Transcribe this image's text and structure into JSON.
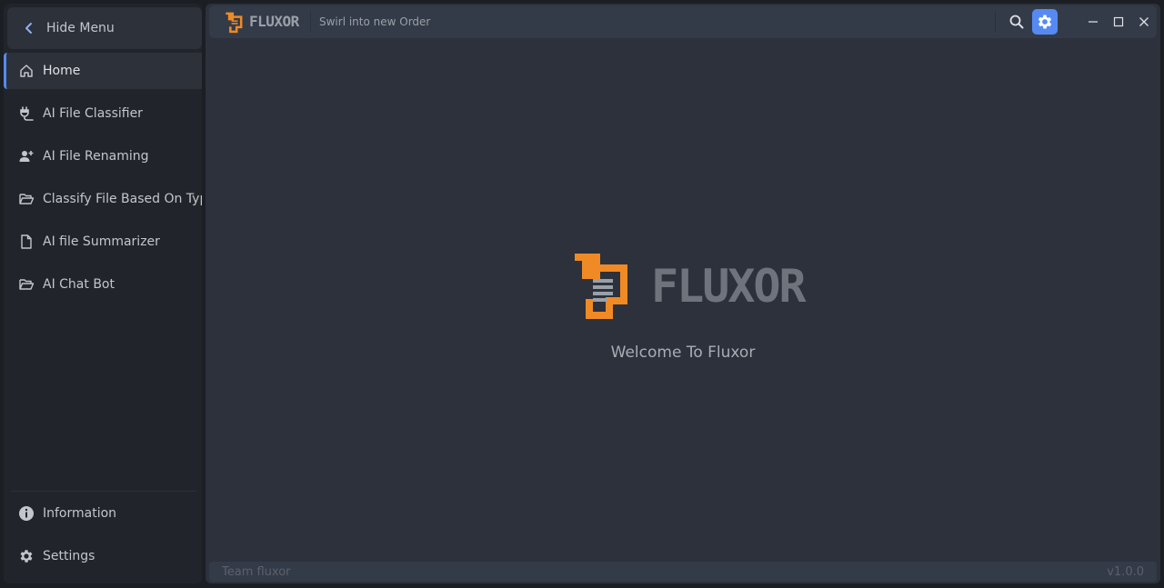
{
  "sidebar": {
    "toggle_label": "Hide Menu",
    "items": [
      {
        "label": "Home",
        "icon": "home-icon",
        "active": true
      },
      {
        "label": "AI File Classifier",
        "icon": "plug-icon"
      },
      {
        "label": "AI File Renaming",
        "icon": "add-user-icon"
      },
      {
        "label": "Classify File Based On Type",
        "icon": "folder-open-icon"
      },
      {
        "label": "AI file Summarizer",
        "icon": "file-icon"
      },
      {
        "label": "AI Chat Bot",
        "icon": "folder-open-icon"
      }
    ],
    "bottom_items": [
      {
        "label": "Information",
        "icon": "info-icon"
      },
      {
        "label": "Settings",
        "icon": "gear-icon"
      }
    ]
  },
  "titlebar": {
    "app_name": "FLUXOR",
    "tagline": "Swirl into new Order"
  },
  "content": {
    "logo_text": "FLUXOR",
    "welcome": "Welcome To Fluxor"
  },
  "footer": {
    "credits": "Team fluxor",
    "version": "v1.0.0"
  },
  "colors": {
    "accent": "#568af2",
    "brand_orange": "#f08a24",
    "sidebar_bg": "#21252b",
    "main_bg": "#2c313c"
  }
}
